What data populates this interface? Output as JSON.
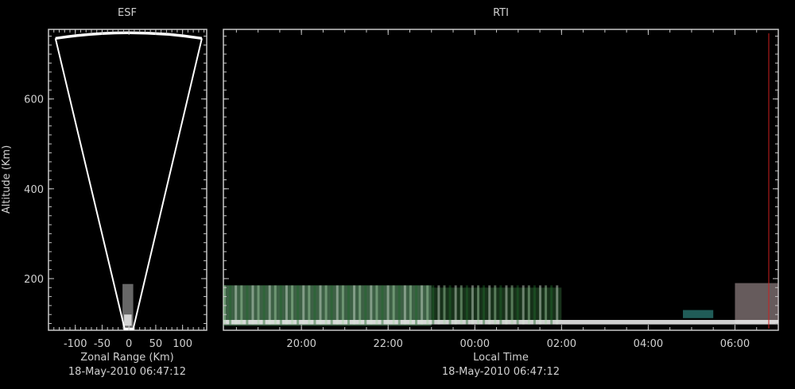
{
  "colors": {
    "background": "#000000",
    "axis": "#c8c8c8",
    "text": "#d0d0d0",
    "fan": "#ffffff",
    "marker": "#cc2020"
  },
  "chart_data": [
    {
      "type": "heatmap",
      "title": "ESF",
      "xlabel": "Zonal Range (Km)",
      "ylabel": "Altitude (Km)",
      "footer": "18-May-2010 06:47:12",
      "xlim": [
        -150,
        145
      ],
      "ylim": [
        85,
        755
      ],
      "x_ticks": [
        -100,
        -50,
        0,
        50,
        100
      ],
      "x_tick_labels": [
        "-100",
        "-50",
        "0",
        "50",
        "100"
      ],
      "y_ticks": [
        200,
        400,
        600
      ],
      "y_tick_labels": [
        "200",
        "400",
        "600"
      ],
      "beam_fan": {
        "apex_range": 0,
        "apex_alt": 88,
        "edge_left_range": -137,
        "edge_right_range": 136,
        "edge_alt": 735,
        "top_alt": 748
      },
      "echo_region": {
        "range": [
          -12,
          8
        ],
        "alt": [
          88,
          188
        ]
      }
    },
    {
      "type": "heatmap",
      "title": "RTI",
      "xlabel": "Local Time",
      "ylabel": "",
      "footer": "18-May-2010 06:47:12",
      "xlim_hours": [
        18.2,
        31.0
      ],
      "ylim": [
        85,
        755
      ],
      "x_ticks_hours": [
        20,
        22,
        24,
        26,
        28,
        30
      ],
      "x_tick_labels": [
        "20:00",
        "22:00",
        "00:00",
        "02:00",
        "04:00",
        "06:00"
      ],
      "y_ticks": [
        200,
        400,
        600
      ],
      "current_time_marker_hours": 30.78,
      "echo_layers": [
        {
          "t": [
            18.2,
            23.0
          ],
          "alt": [
            95,
            185
          ],
          "color": "#6fae7d"
        },
        {
          "t": [
            23.0,
            26.0
          ],
          "alt": [
            105,
            180
          ],
          "color": "#2a5a30"
        },
        {
          "t": [
            28.8,
            29.5
          ],
          "alt": [
            112,
            130
          ],
          "color": "#3aa7a0"
        },
        {
          "t": [
            30.0,
            31.0
          ],
          "alt": [
            100,
            190
          ],
          "color": "#b9a6a8"
        },
        {
          "t": [
            18.2,
            31.0
          ],
          "alt": [
            98,
            108
          ],
          "color": "#e8e8e8"
        }
      ]
    }
  ]
}
